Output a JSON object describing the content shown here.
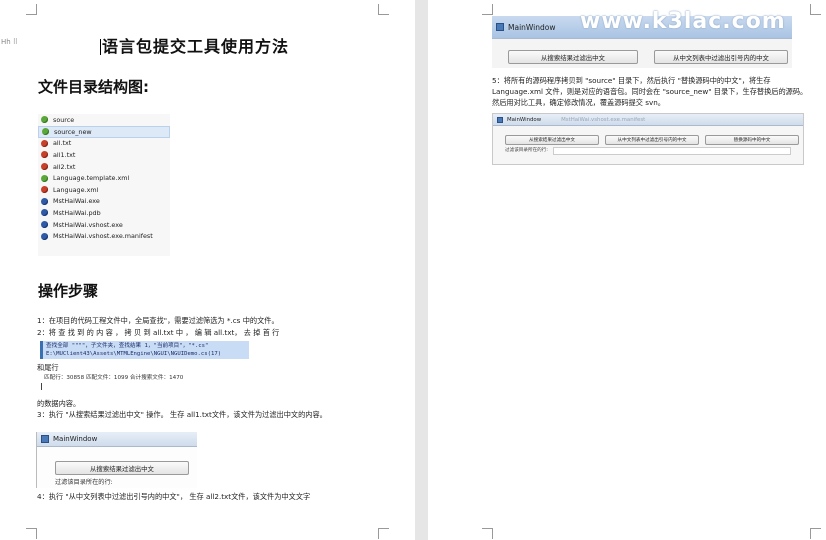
{
  "left_page": {
    "margin_marker": "Hh ⠿",
    "title": "语言包提交工具使用方法",
    "heading_structure": "文件目录结构图:",
    "files": [
      {
        "name": "source",
        "icon": "green-check-icon"
      },
      {
        "name": "source_new",
        "icon": "green-check-icon"
      },
      {
        "name": "all.txt",
        "icon": "red-excl-icon"
      },
      {
        "name": "all1.txt",
        "icon": "red-excl-icon"
      },
      {
        "name": "all2.txt",
        "icon": "red-excl-icon"
      },
      {
        "name": "Language.template.xml",
        "icon": "green-check-icon"
      },
      {
        "name": "Language.xml",
        "icon": "red-excl-icon"
      },
      {
        "name": "MstHaiWai.exe",
        "icon": "blue-q-icon"
      },
      {
        "name": "MstHaiWai.pdb",
        "icon": "blue-q-icon"
      },
      {
        "name": "MstHaiWai.vshost.exe",
        "icon": "blue-q-icon"
      },
      {
        "name": "MstHaiWai.vshost.exe.manifest",
        "icon": "blue-q-icon"
      }
    ],
    "heading_steps": "操作步骤",
    "step1": "1：在项目的代码工程文件中，全局查找\"，需要过滤筛选为 *.cs 中的文件。",
    "step2a": "2：将 查 找 到 的 内 容 ， 拷 贝 到  all.txt  中 ， 编 辑  all.txt， 去 掉 首 行",
    "find_line1": "查找全部 \"\"\"\"，子文件夹，查找结果 1，\"当前项目\"，\"*.cs\"",
    "find_line2": "  E:\\MUClient43\\Assets\\MTMLEngine\\NGUI\\NGUIDemo.cs(17)",
    "step2b": "和尾行",
    "find_summary": "匹配行：30858     匹配文件：1099     合计搜索文件：1470",
    "step2c": "的数据内容。",
    "step3": "3：执行 \"从搜索结果过滤出中文\"  操作。  生存 all1.txt文件，该文件为过滤出中文的内容。",
    "window_title": "MainWindow",
    "btn_filter_search": "从搜索结果过滤出中文",
    "label_filter_path": "过滤该目录所在的行:",
    "step4": "4：执行 \"从中文列表中过滤出引号内的中文\"，  生存 all2.txt文件，该文件为中文文字"
  },
  "right_page": {
    "window_title": "MainWindow",
    "watermark": "www.k3lac.com",
    "btn_filter_search": "从搜索结果过滤出中文",
    "btn_filter_quote": "从中文列表中过滤出引号内的中文",
    "step5": "5：将所有的源码程序拷贝到 \"source\" 目录下，然后执行 \"替换源码中的中文\"，将生存 Language.xml 文件，则是对应的语音包。同时会在 \"source_new\" 目录下，生存替换后的源码。 然后用对比工具，确定修改情况，覆盖源码提交 svn。",
    "win2_title": "MainWindow",
    "win2_title_faded": "MstHaiWai.vshost.exe.manifest",
    "win2_btn1": "从搜索结果过滤出中文",
    "win2_btn2": "从中文列表中过滤出引号内的中文",
    "win2_btn3": "替换源码中的中文",
    "win2_label": "过滤该目录所在的行:"
  }
}
